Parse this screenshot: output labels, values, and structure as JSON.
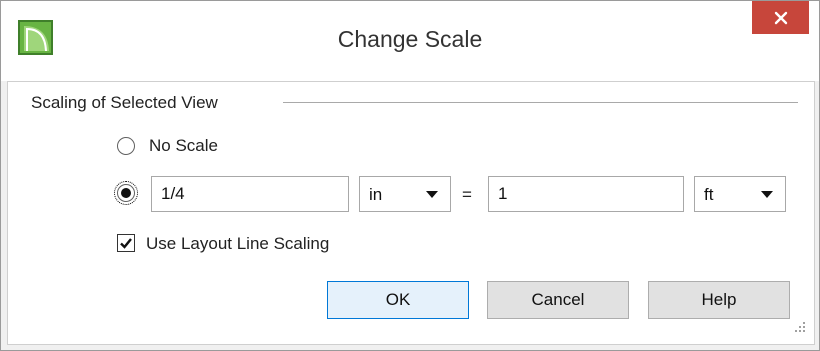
{
  "dialog": {
    "title": "Change Scale",
    "app_icon": "chief-architect-logo-icon",
    "close_icon": "close-icon"
  },
  "group": {
    "label": "Scaling of Selected View"
  },
  "options": {
    "no_scale_label": "No Scale",
    "selected": "custom-scale"
  },
  "scale": {
    "left_value": "1/4",
    "left_unit": "in",
    "equals": "=",
    "right_value": "1",
    "right_unit": "ft"
  },
  "layout_line": {
    "label": "Use Layout Line Scaling",
    "checked": true
  },
  "buttons": {
    "ok": "OK",
    "cancel": "Cancel",
    "help": "Help"
  },
  "colors": {
    "close_bg": "#c7463b",
    "default_border": "#0078d7",
    "logo_green": "#5fa83c"
  }
}
